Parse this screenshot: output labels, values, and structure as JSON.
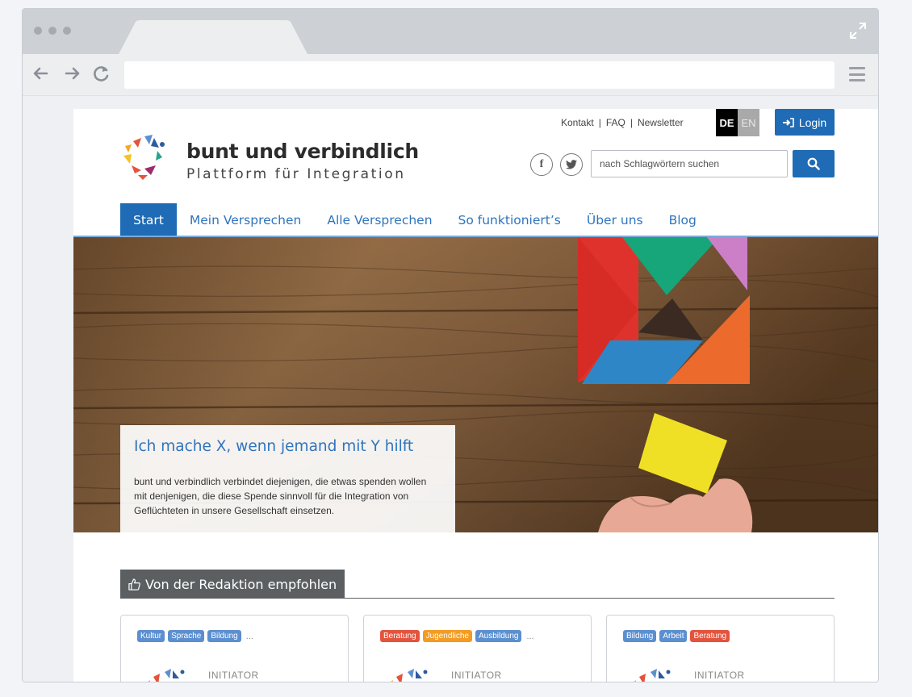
{
  "page": {
    "top_links": [
      "Kontakt",
      "FAQ",
      "Newsletter"
    ],
    "lang": {
      "de": "DE",
      "en": "EN"
    },
    "login_label": "Login",
    "brand": {
      "title": "bunt und verbindlich",
      "subtitle": "Plattform für Integration"
    },
    "social": {
      "facebook": "f",
      "twitter": "t"
    },
    "search": {
      "placeholder": "nach Schlagwörtern suchen",
      "value": ""
    },
    "nav": [
      "Start",
      "Mein Versprechen",
      "Alle Versprechen",
      "So funktioniert’s",
      "Über uns",
      "Blog"
    ],
    "hero": {
      "title": "Ich mache X, wenn jemand mit Y hilft",
      "text": "bunt und verbindlich verbindet diejenigen, die etwas spenden wollen mit denjenigen, die diese Spende sinnvoll für die Integration von Geflüchteten in unsere Gesellschaft einsetzen."
    },
    "recommended_label": "Von der Redaktion empfohlen",
    "cards": [
      {
        "tags": [
          "Kultur",
          "Sprache",
          "Bildung"
        ],
        "ellipsis": "...",
        "initiator": "INITIATOR"
      },
      {
        "tags": [
          "Beratung",
          "Jugendliche",
          "Ausbildung"
        ],
        "ellipsis": "...",
        "initiator": "INITIATOR"
      },
      {
        "tags": [
          "Bildung",
          "Arbeit",
          "Beratung"
        ],
        "ellipsis": "",
        "initiator": "INITIATOR"
      }
    ]
  },
  "colors": {
    "primary": "#1f6bb5",
    "link": "#2f74bd",
    "tag_blue": "#5b8fd0",
    "tag_red": "#e4533d",
    "tag_orange": "#f39b22"
  }
}
